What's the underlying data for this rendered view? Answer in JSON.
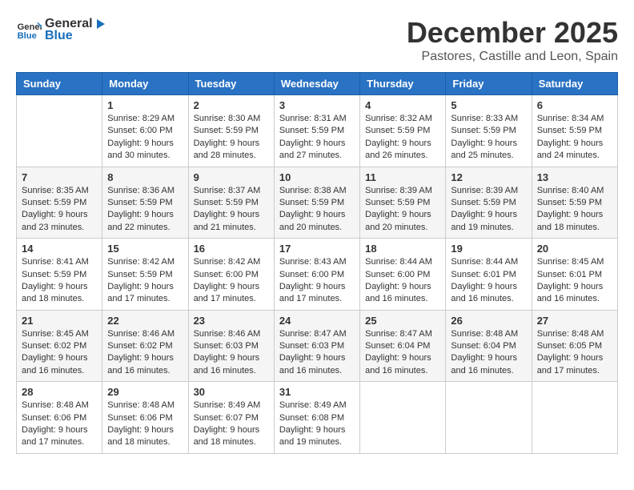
{
  "header": {
    "logo_general": "General",
    "logo_blue": "Blue",
    "title": "December 2025",
    "subtitle": "Pastores, Castille and Leon, Spain"
  },
  "days_of_week": [
    "Sunday",
    "Monday",
    "Tuesday",
    "Wednesday",
    "Thursday",
    "Friday",
    "Saturday"
  ],
  "weeks": [
    [
      {
        "day": "",
        "sunrise": "",
        "sunset": "",
        "daylight": ""
      },
      {
        "day": "1",
        "sunrise": "Sunrise: 8:29 AM",
        "sunset": "Sunset: 6:00 PM",
        "daylight": "Daylight: 9 hours and 30 minutes."
      },
      {
        "day": "2",
        "sunrise": "Sunrise: 8:30 AM",
        "sunset": "Sunset: 5:59 PM",
        "daylight": "Daylight: 9 hours and 28 minutes."
      },
      {
        "day": "3",
        "sunrise": "Sunrise: 8:31 AM",
        "sunset": "Sunset: 5:59 PM",
        "daylight": "Daylight: 9 hours and 27 minutes."
      },
      {
        "day": "4",
        "sunrise": "Sunrise: 8:32 AM",
        "sunset": "Sunset: 5:59 PM",
        "daylight": "Daylight: 9 hours and 26 minutes."
      },
      {
        "day": "5",
        "sunrise": "Sunrise: 8:33 AM",
        "sunset": "Sunset: 5:59 PM",
        "daylight": "Daylight: 9 hours and 25 minutes."
      },
      {
        "day": "6",
        "sunrise": "Sunrise: 8:34 AM",
        "sunset": "Sunset: 5:59 PM",
        "daylight": "Daylight: 9 hours and 24 minutes."
      }
    ],
    [
      {
        "day": "7",
        "sunrise": "Sunrise: 8:35 AM",
        "sunset": "Sunset: 5:59 PM",
        "daylight": "Daylight: 9 hours and 23 minutes."
      },
      {
        "day": "8",
        "sunrise": "Sunrise: 8:36 AM",
        "sunset": "Sunset: 5:59 PM",
        "daylight": "Daylight: 9 hours and 22 minutes."
      },
      {
        "day": "9",
        "sunrise": "Sunrise: 8:37 AM",
        "sunset": "Sunset: 5:59 PM",
        "daylight": "Daylight: 9 hours and 21 minutes."
      },
      {
        "day": "10",
        "sunrise": "Sunrise: 8:38 AM",
        "sunset": "Sunset: 5:59 PM",
        "daylight": "Daylight: 9 hours and 20 minutes."
      },
      {
        "day": "11",
        "sunrise": "Sunrise: 8:39 AM",
        "sunset": "Sunset: 5:59 PM",
        "daylight": "Daylight: 9 hours and 20 minutes."
      },
      {
        "day": "12",
        "sunrise": "Sunrise: 8:39 AM",
        "sunset": "Sunset: 5:59 PM",
        "daylight": "Daylight: 9 hours and 19 minutes."
      },
      {
        "day": "13",
        "sunrise": "Sunrise: 8:40 AM",
        "sunset": "Sunset: 5:59 PM",
        "daylight": "Daylight: 9 hours and 18 minutes."
      }
    ],
    [
      {
        "day": "14",
        "sunrise": "Sunrise: 8:41 AM",
        "sunset": "Sunset: 5:59 PM",
        "daylight": "Daylight: 9 hours and 18 minutes."
      },
      {
        "day": "15",
        "sunrise": "Sunrise: 8:42 AM",
        "sunset": "Sunset: 5:59 PM",
        "daylight": "Daylight: 9 hours and 17 minutes."
      },
      {
        "day": "16",
        "sunrise": "Sunrise: 8:42 AM",
        "sunset": "Sunset: 6:00 PM",
        "daylight": "Daylight: 9 hours and 17 minutes."
      },
      {
        "day": "17",
        "sunrise": "Sunrise: 8:43 AM",
        "sunset": "Sunset: 6:00 PM",
        "daylight": "Daylight: 9 hours and 17 minutes."
      },
      {
        "day": "18",
        "sunrise": "Sunrise: 8:44 AM",
        "sunset": "Sunset: 6:00 PM",
        "daylight": "Daylight: 9 hours and 16 minutes."
      },
      {
        "day": "19",
        "sunrise": "Sunrise: 8:44 AM",
        "sunset": "Sunset: 6:01 PM",
        "daylight": "Daylight: 9 hours and 16 minutes."
      },
      {
        "day": "20",
        "sunrise": "Sunrise: 8:45 AM",
        "sunset": "Sunset: 6:01 PM",
        "daylight": "Daylight: 9 hours and 16 minutes."
      }
    ],
    [
      {
        "day": "21",
        "sunrise": "Sunrise: 8:45 AM",
        "sunset": "Sunset: 6:02 PM",
        "daylight": "Daylight: 9 hours and 16 minutes."
      },
      {
        "day": "22",
        "sunrise": "Sunrise: 8:46 AM",
        "sunset": "Sunset: 6:02 PM",
        "daylight": "Daylight: 9 hours and 16 minutes."
      },
      {
        "day": "23",
        "sunrise": "Sunrise: 8:46 AM",
        "sunset": "Sunset: 6:03 PM",
        "daylight": "Daylight: 9 hours and 16 minutes."
      },
      {
        "day": "24",
        "sunrise": "Sunrise: 8:47 AM",
        "sunset": "Sunset: 6:03 PM",
        "daylight": "Daylight: 9 hours and 16 minutes."
      },
      {
        "day": "25",
        "sunrise": "Sunrise: 8:47 AM",
        "sunset": "Sunset: 6:04 PM",
        "daylight": "Daylight: 9 hours and 16 minutes."
      },
      {
        "day": "26",
        "sunrise": "Sunrise: 8:48 AM",
        "sunset": "Sunset: 6:04 PM",
        "daylight": "Daylight: 9 hours and 16 minutes."
      },
      {
        "day": "27",
        "sunrise": "Sunrise: 8:48 AM",
        "sunset": "Sunset: 6:05 PM",
        "daylight": "Daylight: 9 hours and 17 minutes."
      }
    ],
    [
      {
        "day": "28",
        "sunrise": "Sunrise: 8:48 AM",
        "sunset": "Sunset: 6:06 PM",
        "daylight": "Daylight: 9 hours and 17 minutes."
      },
      {
        "day": "29",
        "sunrise": "Sunrise: 8:48 AM",
        "sunset": "Sunset: 6:06 PM",
        "daylight": "Daylight: 9 hours and 18 minutes."
      },
      {
        "day": "30",
        "sunrise": "Sunrise: 8:49 AM",
        "sunset": "Sunset: 6:07 PM",
        "daylight": "Daylight: 9 hours and 18 minutes."
      },
      {
        "day": "31",
        "sunrise": "Sunrise: 8:49 AM",
        "sunset": "Sunset: 6:08 PM",
        "daylight": "Daylight: 9 hours and 19 minutes."
      },
      {
        "day": "",
        "sunrise": "",
        "sunset": "",
        "daylight": ""
      },
      {
        "day": "",
        "sunrise": "",
        "sunset": "",
        "daylight": ""
      },
      {
        "day": "",
        "sunrise": "",
        "sunset": "",
        "daylight": ""
      }
    ]
  ],
  "row_shading": [
    false,
    true,
    false,
    true,
    false
  ]
}
